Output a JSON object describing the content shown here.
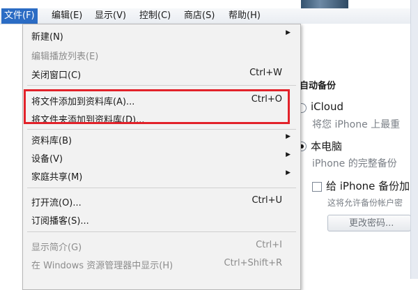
{
  "menubar": {
    "items": [
      "文件(F)",
      "编辑(E)",
      "显示(V)",
      "控制(C)",
      "商店(S)",
      "帮助(H)"
    ],
    "active_index": 0
  },
  "file_menu": {
    "items": [
      {
        "label": "新建(N)",
        "shortcut": "",
        "submenu": true,
        "disabled": false
      },
      {
        "label": "编辑播放列表(E)",
        "shortcut": "",
        "submenu": false,
        "disabled": true
      },
      {
        "label": "关闭窗口(C)",
        "shortcut": "Ctrl+W",
        "submenu": false,
        "disabled": false
      },
      {
        "label": "将文件添加到资料库(A)...",
        "shortcut": "Ctrl+O",
        "submenu": false,
        "disabled": false
      },
      {
        "label": "将文件夹添加到资料库(D)...",
        "shortcut": "",
        "submenu": false,
        "disabled": false
      },
      {
        "label": "资料库(B)",
        "shortcut": "",
        "submenu": true,
        "disabled": false
      },
      {
        "label": "设备(V)",
        "shortcut": "",
        "submenu": true,
        "disabled": false
      },
      {
        "label": "家庭共享(M)",
        "shortcut": "",
        "submenu": true,
        "disabled": false
      },
      {
        "label": "打开流(O)...",
        "shortcut": "Ctrl+U",
        "submenu": false,
        "disabled": false
      },
      {
        "label": "订阅播客(S)...",
        "shortcut": "",
        "submenu": false,
        "disabled": false
      },
      {
        "label": "显示简介(G)",
        "shortcut": "Ctrl+I",
        "submenu": false,
        "disabled": true
      },
      {
        "label": "在 Windows 资源管理器中显示(H)",
        "shortcut": "Ctrl+Shift+R",
        "submenu": false,
        "disabled": true
      }
    ],
    "submenu_arrow": "▶"
  },
  "backup_panel": {
    "section_title": "自动备份",
    "icloud_label": "iCloud",
    "icloud_desc": "将您 iPhone 上最重",
    "this_computer_label": "本电脑",
    "this_computer_desc": "iPhone 的完整备份",
    "encrypt_label": "给 iPhone 备份加",
    "encrypt_desc": "这将允许备份帐户密",
    "change_password_button": "更改密码..."
  }
}
